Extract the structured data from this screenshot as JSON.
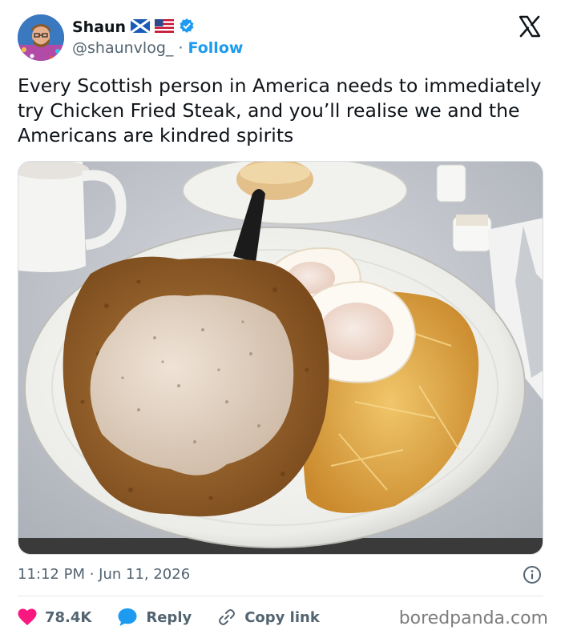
{
  "author": {
    "name": "Shaun",
    "handle": "@shaunvlog_",
    "separator": "·",
    "follow_label": "Follow",
    "flags": [
      "scotland-flag-icon",
      "us-flag-icon"
    ],
    "verified_badge": "verified-badge-icon"
  },
  "platform_logo": "x-logo-icon",
  "tweet": {
    "text": "Every Scottish person in America needs to immediately try Chicken Fried Steak, and you’ll realise we and the Americans are kindred spirits"
  },
  "photo": {
    "subject": "chicken-fried-steak-plate-photo"
  },
  "meta": {
    "timestamp": "11:12 PM · Jun 11, 2026",
    "info_icon": "info-icon"
  },
  "actions": {
    "likes": "78.4K",
    "reply_label": "Reply",
    "copy_label": "Copy link"
  },
  "watermark": "boredpanda.com",
  "colors": {
    "accent": "#1d9bf0",
    "like": "#f91880",
    "text": "#0f1419",
    "secondary": "#536471"
  }
}
